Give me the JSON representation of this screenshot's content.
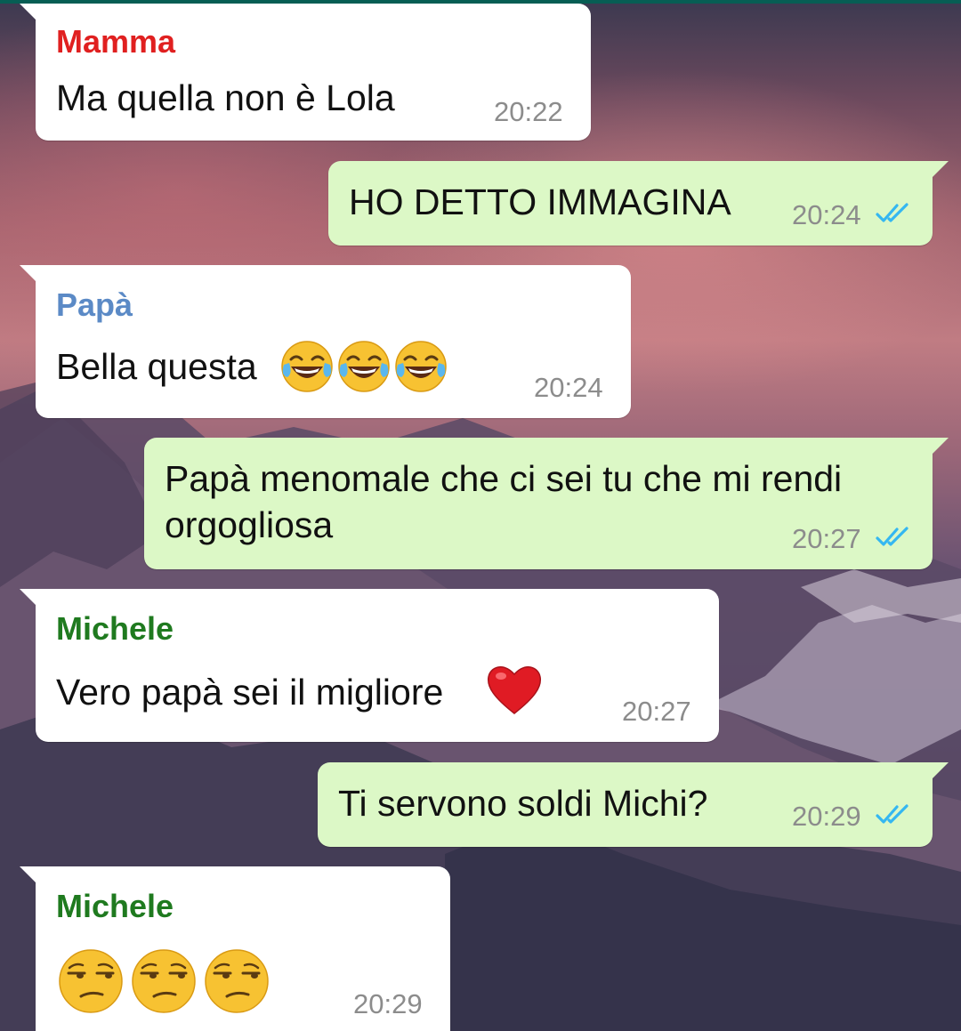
{
  "colors": {
    "incoming_bubble": "#ffffff",
    "outgoing_bubble": "#dcf8c6",
    "time_text": "#8c8c8c",
    "read_ticks": "#34b7f1",
    "sender_mamma": "#e02020",
    "sender_papa": "#5b8ac6",
    "sender_michele": "#1f7a1f"
  },
  "messages": [
    {
      "direction": "incoming",
      "sender": "Mamma",
      "text": "Ma quella non è Lola",
      "time": "20:22"
    },
    {
      "direction": "outgoing",
      "text": "HO DETTO IMMAGINA",
      "time": "20:24",
      "status": "read-double-tick-icon"
    },
    {
      "direction": "incoming",
      "sender": "Papà",
      "text": "Bella questa",
      "emoji": [
        "face-with-tears-of-joy",
        "face-with-tears-of-joy",
        "face-with-tears-of-joy"
      ],
      "time": "20:24"
    },
    {
      "direction": "outgoing",
      "text_line1": "Papà menomale che ci sei tu che mi rendi",
      "text_line2": "orgogliosa",
      "time": "20:27",
      "status": "read-double-tick-icon"
    },
    {
      "direction": "incoming",
      "sender": "Michele",
      "text": "Vero papà sei il migliore",
      "emoji": [
        "red-heart"
      ],
      "time": "20:27"
    },
    {
      "direction": "outgoing",
      "text": "Ti servono soldi Michi?",
      "time": "20:29",
      "status": "read-double-tick-icon"
    },
    {
      "direction": "incoming",
      "sender": "Michele",
      "emoji": [
        "unamused-face",
        "unamused-face",
        "unamused-face"
      ],
      "time": "20:29"
    }
  ]
}
